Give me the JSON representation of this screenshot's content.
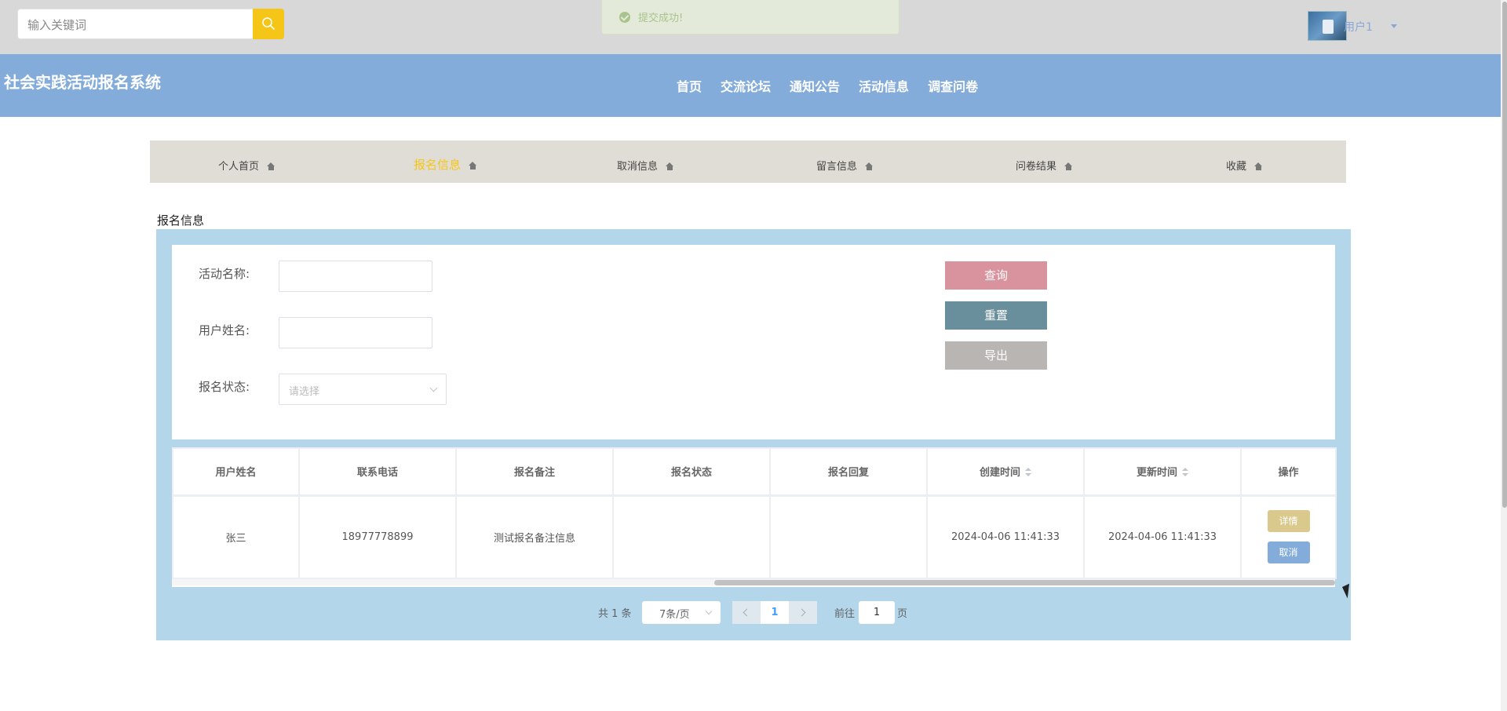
{
  "topbar": {
    "search_placeholder": "输入关键词",
    "toast": "提交成功!",
    "user_name": "用户1"
  },
  "header": {
    "site_title": "社会实践活动报名系统",
    "nav": [
      "首页",
      "交流论坛",
      "通知公告",
      "活动信息",
      "调查问卷"
    ]
  },
  "tabs": [
    "个人首页",
    "报名信息",
    "取消信息",
    "留言信息",
    "问卷结果",
    "收藏"
  ],
  "active_tab": "报名信息",
  "section_title": "报名信息",
  "form": {
    "activity_label": "活动名称:",
    "username_label": "用户姓名:",
    "status_label": "报名状态:",
    "status_placeholder": "请选择",
    "search_btn": "查询",
    "reset_btn": "重置",
    "export_btn": "导出"
  },
  "table": {
    "columns": [
      "用户姓名",
      "联系电话",
      "报名备注",
      "报名状态",
      "报名回复",
      "创建时间",
      "更新时间",
      "操作"
    ],
    "rows": [
      {
        "name": "张三",
        "phone": "18977778899",
        "note": "测试报名备注信息",
        "status": "",
        "reply": "",
        "created": "2024-04-06 11:41:33",
        "updated": "2024-04-06 11:41:33",
        "detail_btn": "详情",
        "cancel_btn": "取消"
      }
    ]
  },
  "pagination": {
    "total": "共 1 条",
    "page_size": "7条/页",
    "current_page": "1",
    "goto_label": "前往",
    "goto_value": "1",
    "page_label": "页"
  },
  "colors": {
    "header_bg": "#83acdb",
    "accent": "#f5c518",
    "panel_bg": "#b3d6ea",
    "search_btn": "#d8939e",
    "reset_btn": "#698f9d",
    "export_btn": "#b8b5b2"
  }
}
